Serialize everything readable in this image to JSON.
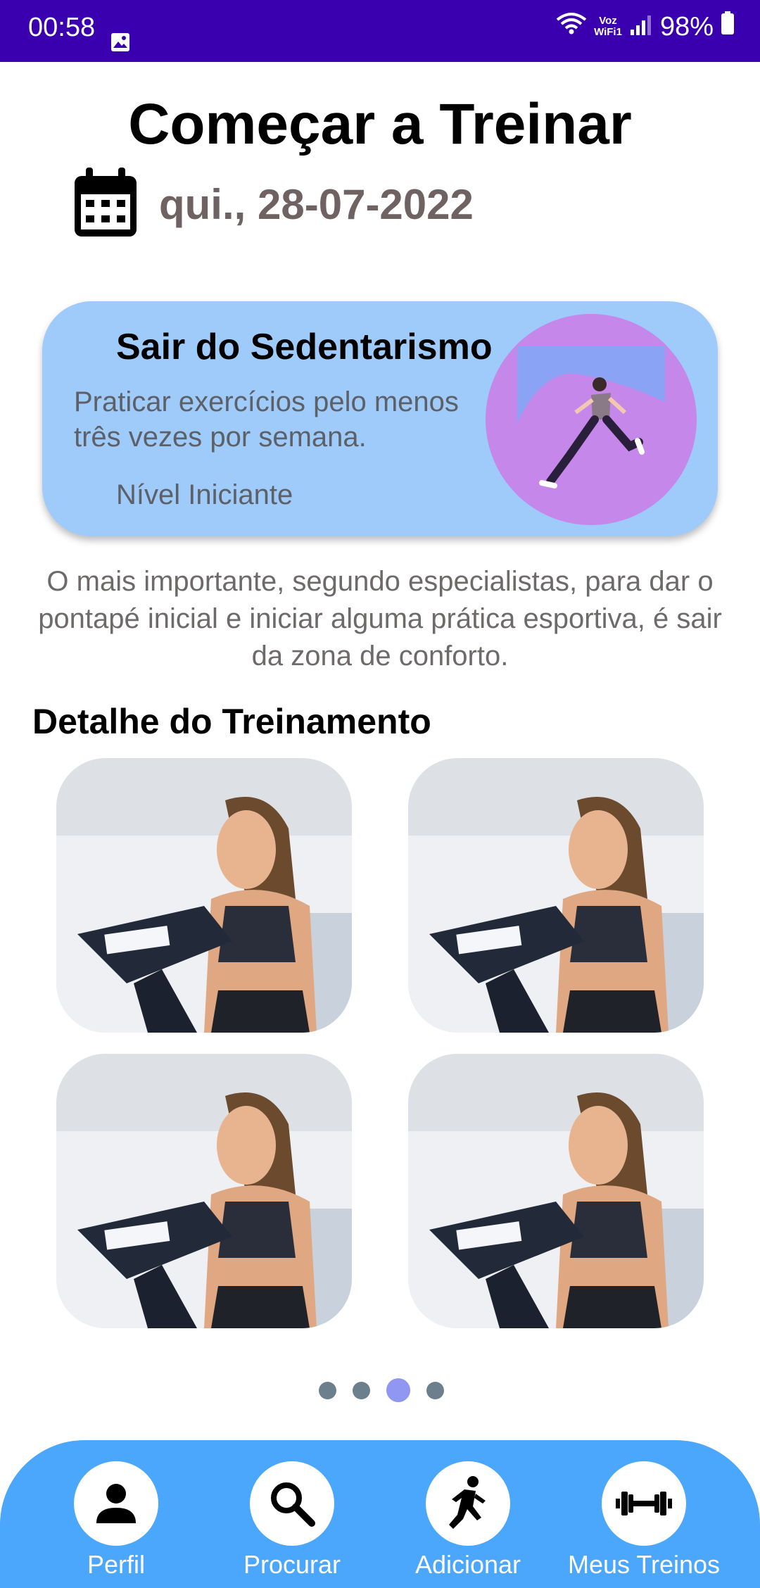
{
  "status_bar": {
    "time": "00:58",
    "carrier": "Voz\nWiFi1",
    "battery": "98%"
  },
  "header": {
    "title": "Começar a Treinar",
    "date": "qui., 28-07-2022"
  },
  "card": {
    "title": "Sair do Sedentarismo",
    "description": "Praticar exercícios pelo menos três vezes por semana.",
    "level": "Nível Iniciante"
  },
  "intro": "O mais importante, segundo especialistas, para dar o pontapé inicial e iniciar alguma prática esportiva, é sair da zona de conforto.",
  "section_title": "Detalhe do Treinamento",
  "pagination": {
    "total": 4,
    "active_index": 2
  },
  "nav": [
    {
      "label": "Perfil",
      "icon": "person-icon"
    },
    {
      "label": "Procurar",
      "icon": "search-icon"
    },
    {
      "label": "Adicionar",
      "icon": "running-icon"
    },
    {
      "label": "Meus Treinos",
      "icon": "dumbbell-icon"
    }
  ],
  "colors": {
    "status_bar": "#3a00b0",
    "card": "#9fcbfb",
    "nav": "#4aa7fb",
    "dot_active": "#8f97f3"
  }
}
